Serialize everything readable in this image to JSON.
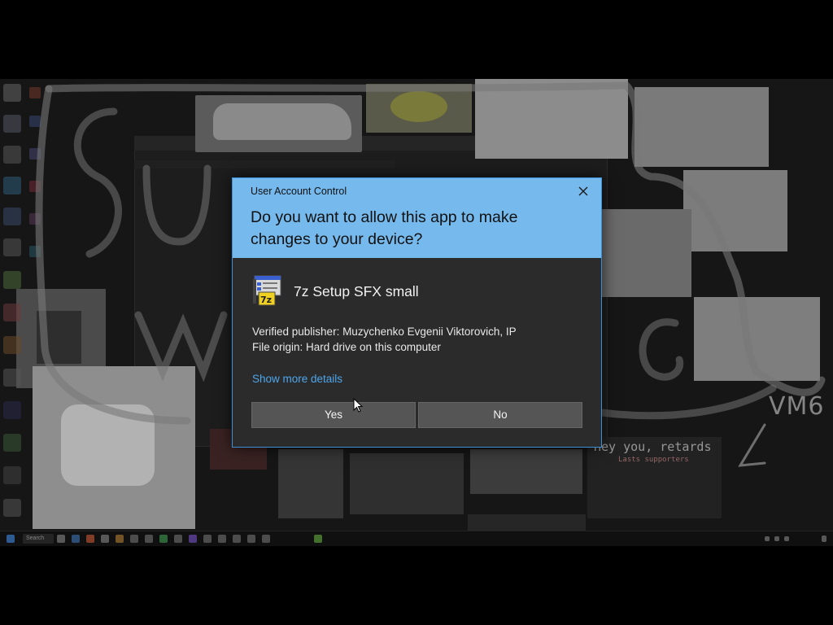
{
  "dialog": {
    "caption": "User Account Control",
    "question": "Do you want to allow this app to make changes to your device?",
    "app_name": "7z Setup SFX small",
    "publisher_line": "Verified publisher: Muzychenko Evgenii Viktorovich, IP",
    "origin_line": "File origin: Hard drive on this computer",
    "show_more": "Show more details",
    "yes_label": "Yes",
    "no_label": "No",
    "close_icon": "close-icon",
    "header_color": "#76b9ed",
    "accent_link_color": "#4ea6ec"
  },
  "background": {
    "overlay_label": "VM6",
    "hey_text": "Hey you, retards",
    "supporters_text": "Lasts supporters"
  },
  "taskbar": {
    "search_placeholder": "Search"
  }
}
